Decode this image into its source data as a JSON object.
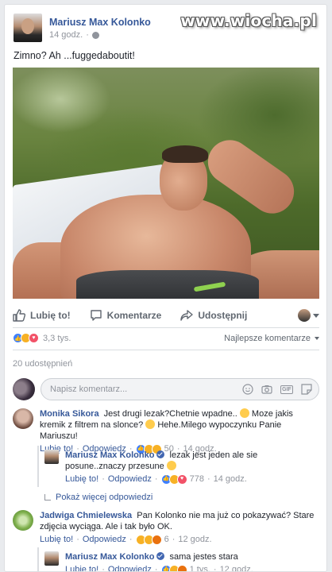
{
  "watermark": "www.wiocha.pl",
  "post": {
    "author": "Mariusz Max Kolonko",
    "time": "14 godz.",
    "text": "Zimno? Ah ...fuggedaboutit!"
  },
  "actions": {
    "like": "Lubię to!",
    "comment": "Komentarze",
    "share": "Udostępnij"
  },
  "reactions": {
    "count": "3,3 tys.",
    "sort_label": "Najlepsze komentarze"
  },
  "shares": "20 udostępnień",
  "composer": {
    "placeholder": "Napisz komentarz..."
  },
  "comments": [
    {
      "name": "Monika Sikora",
      "text": "Jest drugi lezak?Chetnie wpadne..",
      "text2": " Moze jakis kremik z filtrem na slonce?",
      "text3": " Hehe.Milego wypoczynku Panie Mariuszu!",
      "like": "Lubię to!",
      "reply": "Odpowiedz",
      "reactions": "50",
      "time": "14 godz."
    },
    {
      "name": "Mariusz Max Kolonko",
      "text": "lezak jest jeden ale sie posune..znaczy przesune",
      "like": "Lubię to!",
      "reply": "Odpowiedz",
      "reactions": "778",
      "time": "14 godz."
    },
    {
      "name": "Jadwiga Chmielewska",
      "text": "Pan Kolonko nie ma już co pokazywać? Stare zdjęcia wyciąga. Ale i tak było OK.",
      "like": "Lubię to!",
      "reply": "Odpowiedz",
      "reactions": "6",
      "time": "12 godz."
    },
    {
      "name": "Mariusz Max Kolonko",
      "text": "sama jestes stara",
      "like": "Lubię to!",
      "reply": "Odpowiedz",
      "reactions": "1 tys.",
      "time": "12 godz."
    }
  ],
  "more_replies": "Pokaż więcej odpowiedzi",
  "separator": "·",
  "colors": {
    "link": "#365899",
    "brand_blue": "#4267b2",
    "muted": "#90949c",
    "background": "#e9ebee"
  },
  "icons": [
    "like-icon",
    "comment-icon",
    "share-icon",
    "globe-icon",
    "emoji-icon",
    "camera-icon",
    "gif-icon",
    "sticker-icon",
    "verified-icon"
  ]
}
